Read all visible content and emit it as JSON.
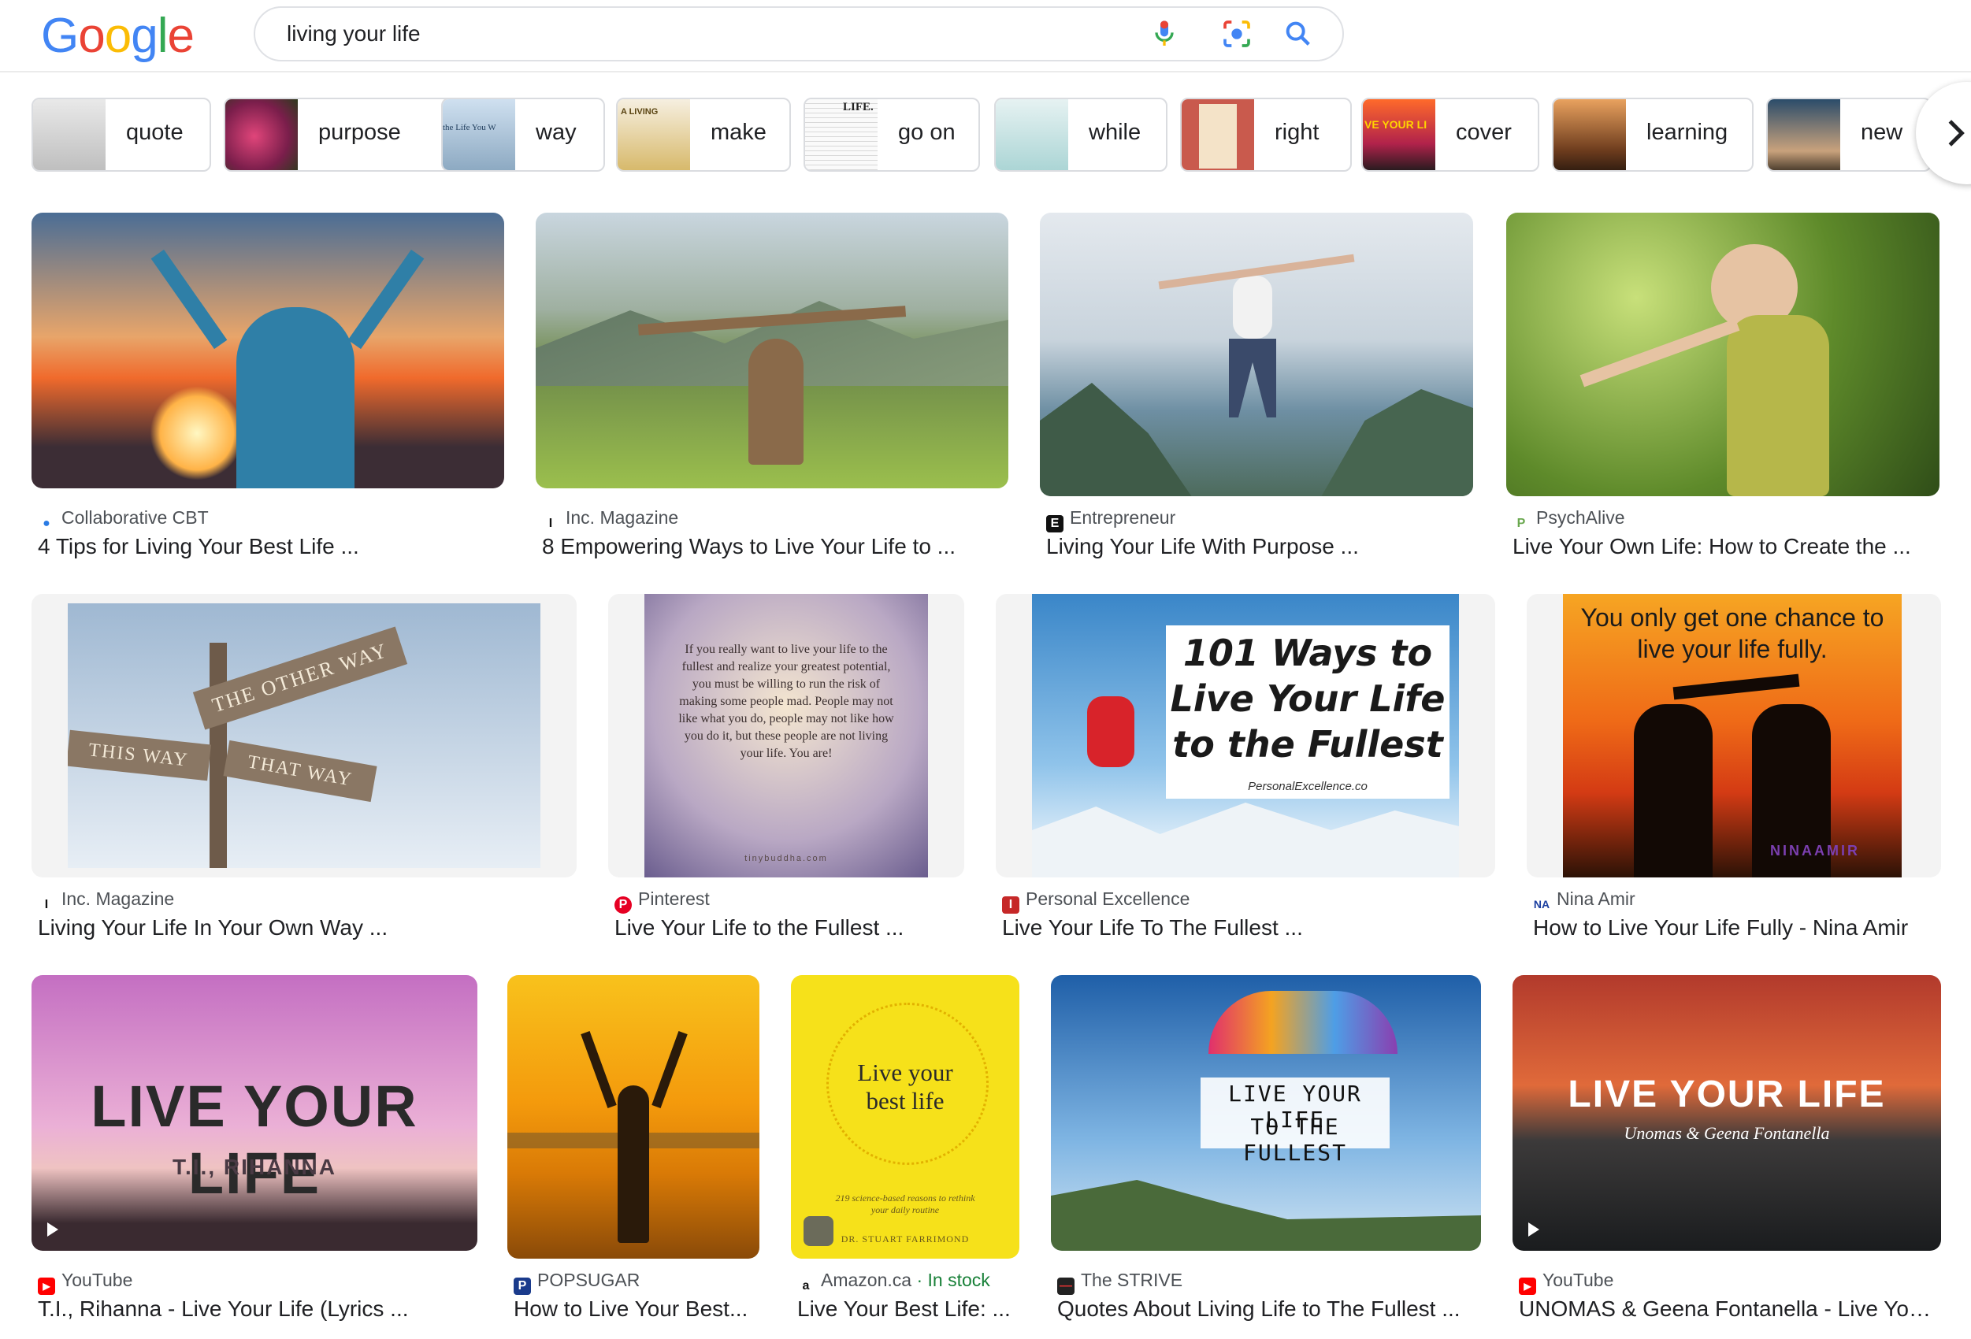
{
  "search": {
    "query": "living your life"
  },
  "logo": {
    "letters": [
      "G",
      "o",
      "o",
      "g",
      "l",
      "e"
    ]
  },
  "chips": [
    {
      "label": "quote"
    },
    {
      "label": "purpose"
    },
    {
      "label": "way"
    },
    {
      "label": "make"
    },
    {
      "label": "go on"
    },
    {
      "label": "while"
    },
    {
      "label": "right"
    },
    {
      "label": "cover"
    },
    {
      "label": "learning"
    },
    {
      "label": "new"
    }
  ],
  "chip_thumb_text": {
    "way": "the Life You W",
    "make": "A LIVING",
    "go_on": "LIFE.",
    "cover": "VE YOUR LI"
  },
  "results": [
    {
      "source": "Collaborative CBT",
      "title": "4 Tips for Living Your Best Life ..."
    },
    {
      "source": "Inc. Magazine",
      "title": "8 Empowering Ways to Live Your Life to ..."
    },
    {
      "source": "Entrepreneur",
      "title": "Living Your Life With Purpose ..."
    },
    {
      "source": "PsychAlive",
      "title": "Live Your Own Life: How to Create the ..."
    },
    {
      "source": "Inc. Magazine",
      "title": "Living Your Life In Your Own Way ..."
    },
    {
      "source": "Pinterest",
      "title": "Live Your Life to the Fullest ..."
    },
    {
      "source": "Personal Excellence",
      "title": "Live Your Life To The Fullest ..."
    },
    {
      "source": "Nina Amir",
      "title": "How to Live Your Life Fully - Nina Amir"
    },
    {
      "source": "YouTube",
      "title": "T.I., Rihanna - Live Your Life (Lyrics ..."
    },
    {
      "source": "POPSUGAR",
      "title": "How to Live Your Best..."
    },
    {
      "source": "Amazon.ca",
      "stock": " · In stock",
      "title": "Live Your Best Life: ..."
    },
    {
      "source": "The STRIVE",
      "title": "Quotes About Living Life to The Fullest ..."
    },
    {
      "source": "YouTube",
      "title": "UNOMAS & Geena Fontanella - Live You..."
    }
  ],
  "image_text": {
    "sign_top": "THE OTHER WAY",
    "sign_left": "THIS WAY",
    "sign_right": "THAT WAY",
    "quote": "If you really want to live your life to the fullest and realize your greatest potential, you must be willing to run the risk of making some people mad. People may not like what you do, people may not like how you do it, but these people are not living your life. You are!",
    "quote_site": "tinybuddha.com",
    "pe_line1": "101 Ways to",
    "pe_line2": "Live Your Life",
    "pe_line3": "to the Fullest",
    "pe_site": "PersonalExcellence.co",
    "nina_top": "You only get one chance to live your life fully.",
    "nina_brand": "NINAAMIR",
    "yt1_title": "LIVE YOUR LIFE",
    "yt1_sub": "T.I., RIHANNA",
    "book_title": "Live your best life",
    "book_sub": "219 science-based reasons to rethink your daily routine",
    "book_author": "DR. STUART FARRIMOND",
    "strive_line1": "LIVE YOUR LIFE",
    "strive_line2": "TO THE FULLEST",
    "yt2_title": "LIVE YOUR LIFE",
    "yt2_sub": "Unomas & Geena Fontanella"
  },
  "colors": {
    "blue": "#4285f4",
    "red": "#ea4335",
    "yellow": "#fbbc05",
    "green": "#34a853",
    "in_stock": "#188038"
  }
}
